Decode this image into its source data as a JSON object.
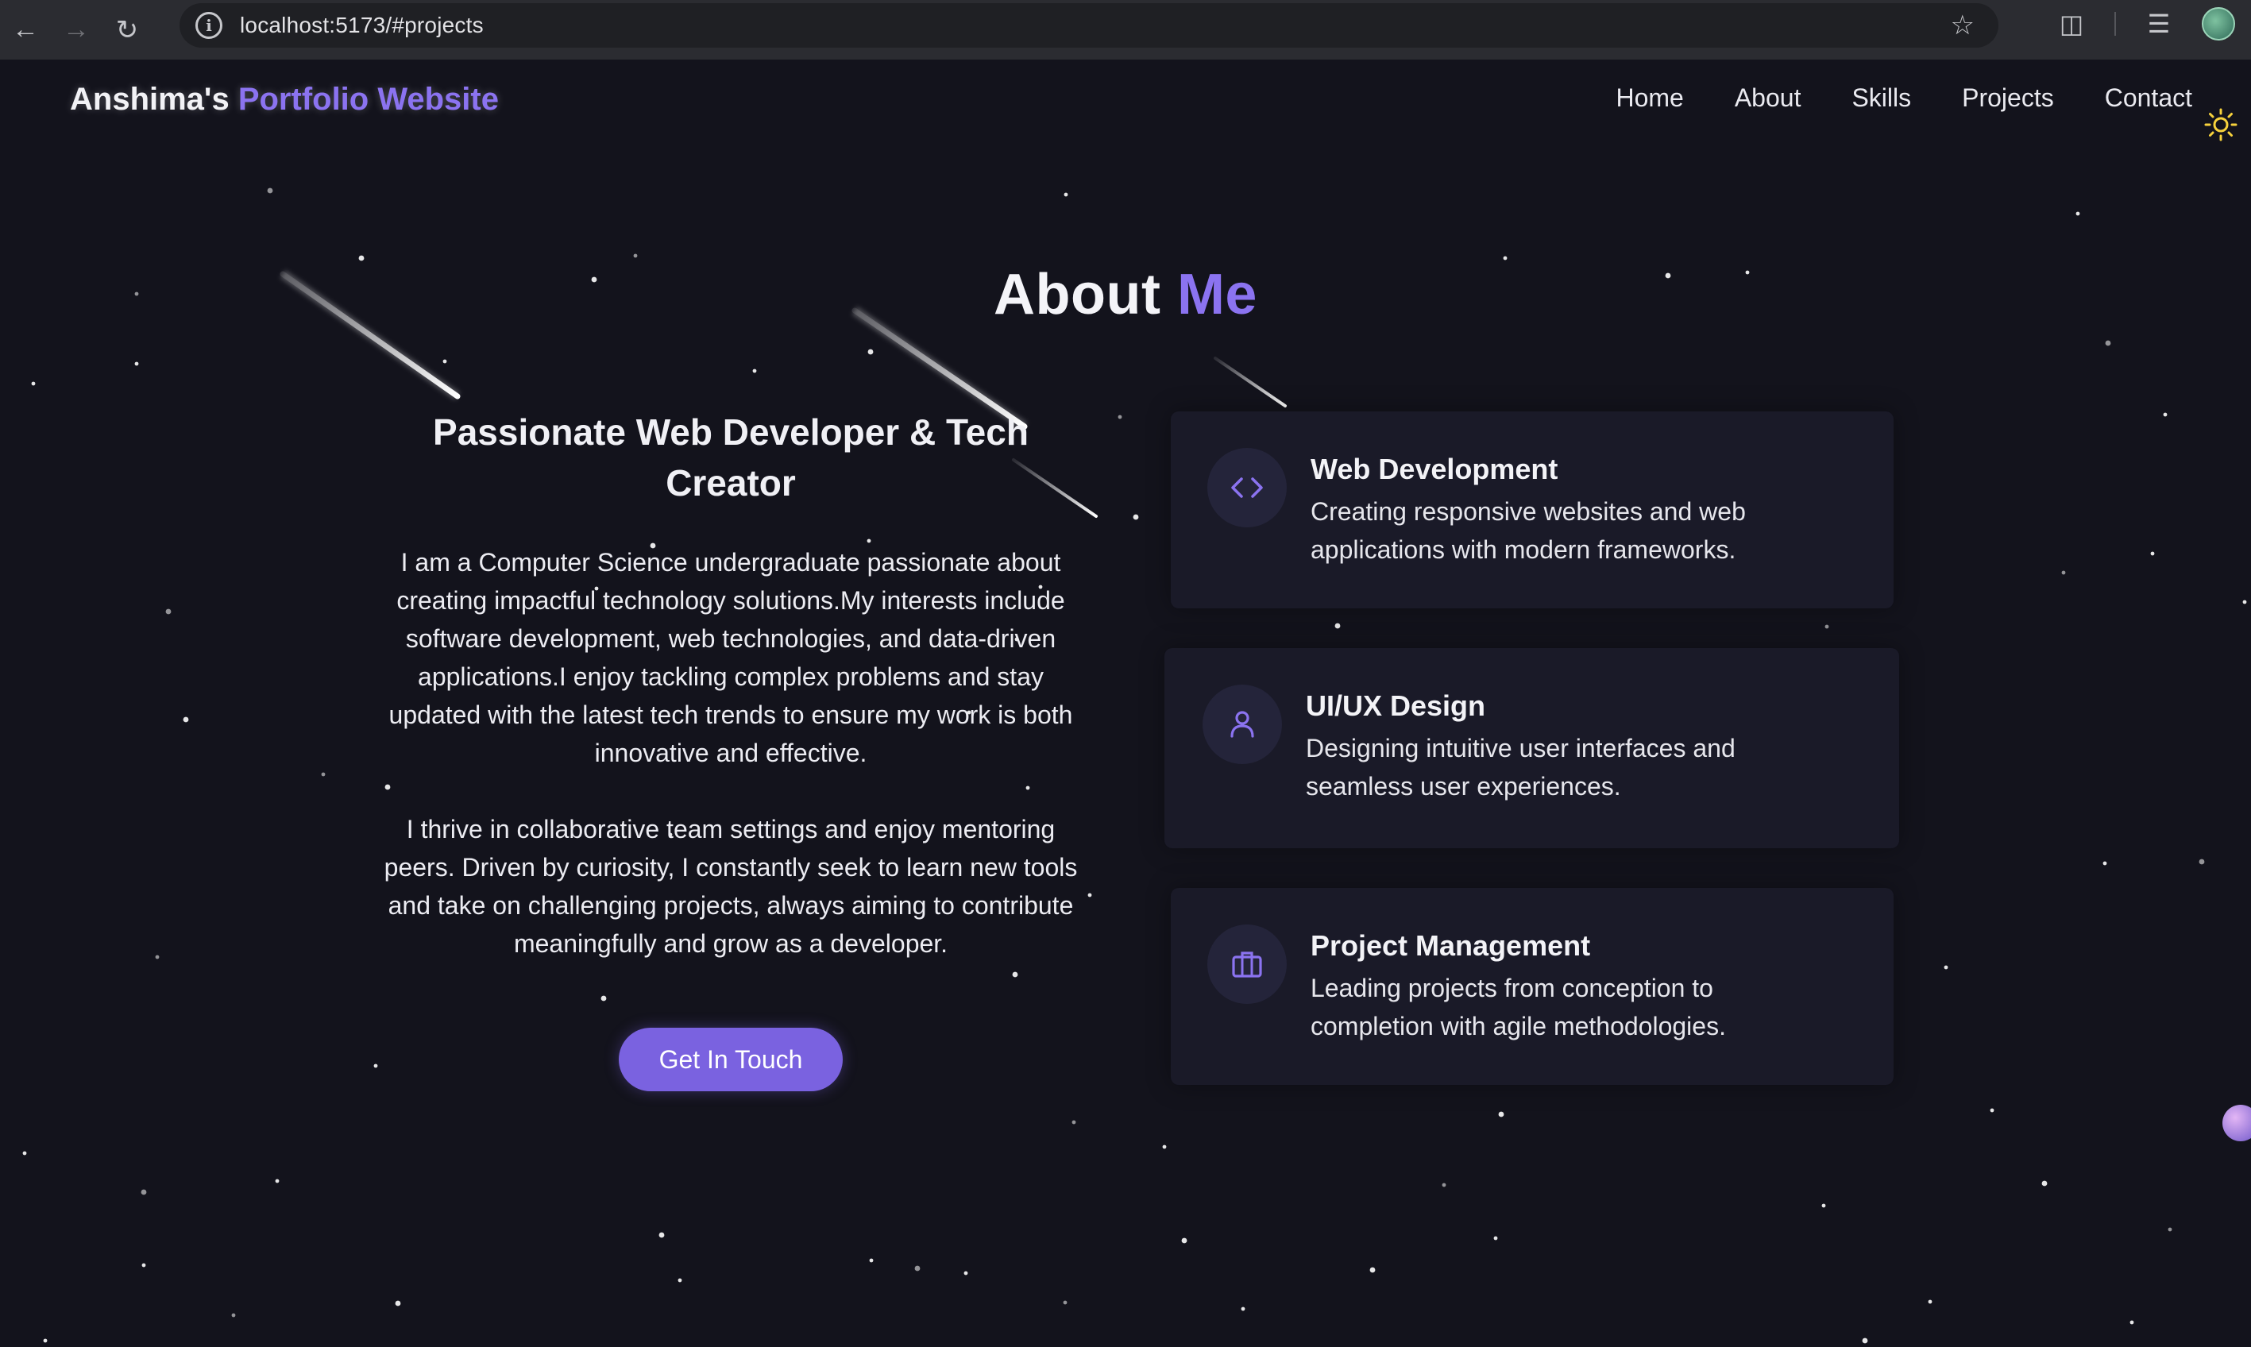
{
  "browser": {
    "url": "localhost:5173/#projects",
    "back_icon": "arrow-left-icon",
    "forward_icon": "arrow-right-icon",
    "reload_icon": "reload-icon"
  },
  "navbar": {
    "brand_name": "Anshima's",
    "brand_accent": "Portfolio Website",
    "links": [
      "Home",
      "About",
      "Skills",
      "Projects",
      "Contact"
    ],
    "theme_icon": "sun-icon"
  },
  "about": {
    "title_main": "About",
    "title_accent": "Me",
    "heading": "Passionate Web Developer & Tech Creator",
    "paragraph1": "I am a Computer Science undergraduate passionate about creating impactful technology solutions.My interests include software development, web technologies, and data-driven applications.I enjoy tackling complex problems and stay updated with the latest tech trends to ensure my work is both innovative and effective.",
    "paragraph2": "I thrive in collaborative team settings and enjoy mentoring peers. Driven by curiosity, I constantly seek to learn new tools and take on challenging projects, always aiming to contribute meaningfully and grow as a developer.",
    "cta_label": "Get In Touch"
  },
  "cards": [
    {
      "title": "Web Development",
      "description": "Creating responsive websites and web applications with modern frameworks.",
      "icon": "code-icon"
    },
    {
      "title": "UI/UX Design",
      "description": "Designing intuitive user interfaces and seamless user experiences.",
      "icon": "user-icon"
    },
    {
      "title": "Project Management",
      "description": "Leading projects from conception to completion with agile methodologies.",
      "icon": "briefcase-icon"
    }
  ],
  "colors": {
    "accent": "#8b73f0",
    "button": "#7a62e0",
    "background": "#13131c",
    "card": "#1a1a28"
  }
}
